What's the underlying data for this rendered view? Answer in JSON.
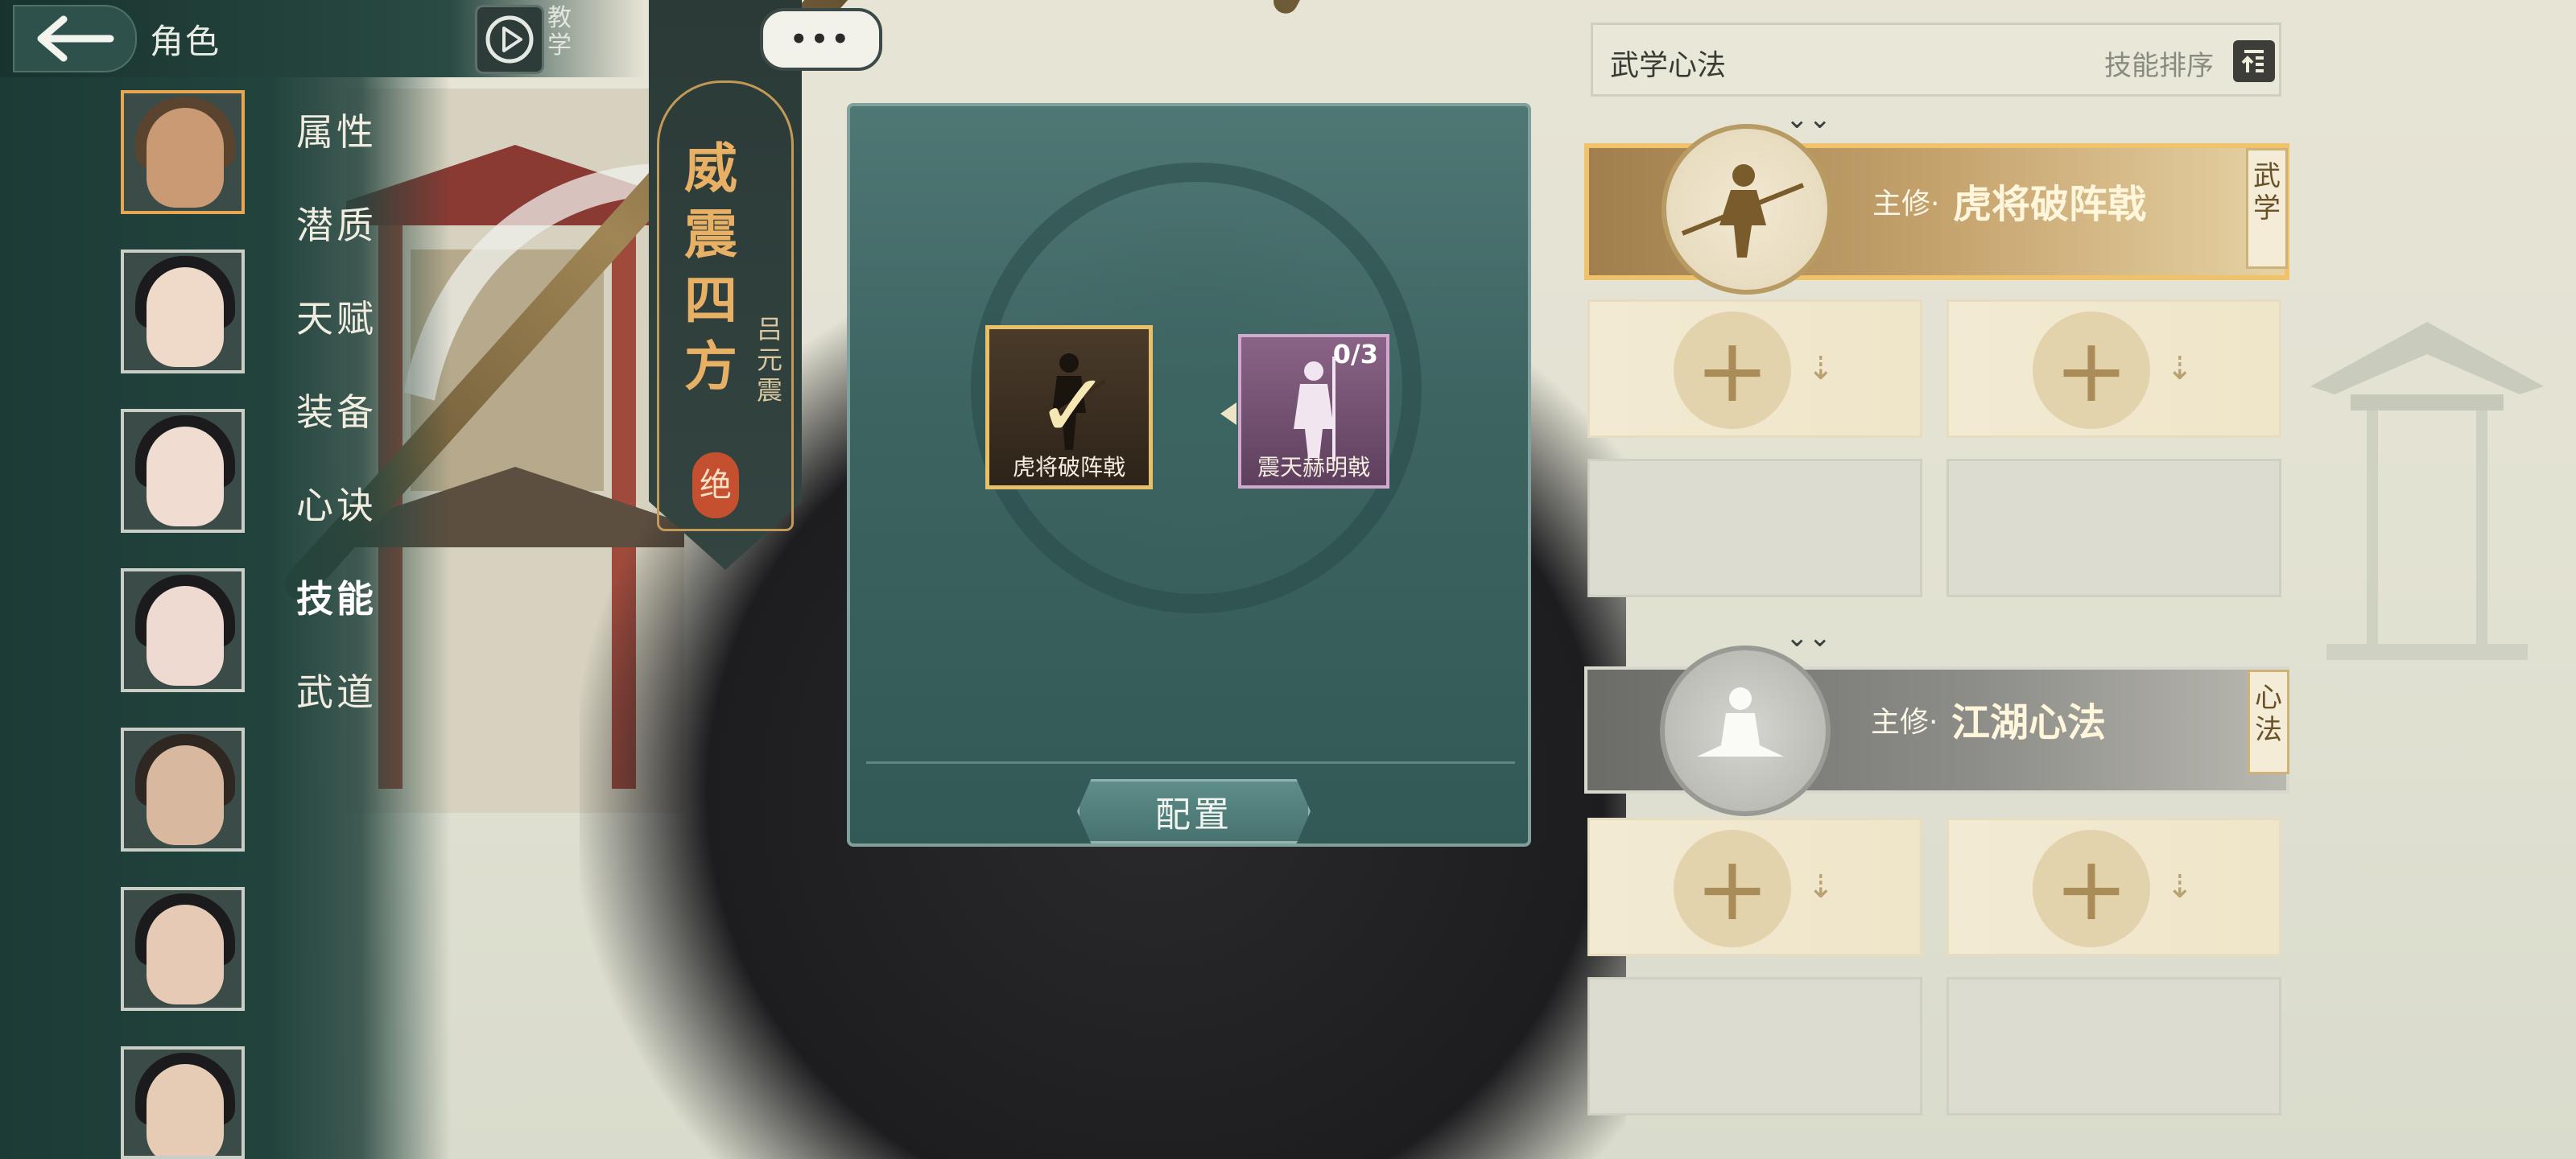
{
  "header": {
    "title": "角色",
    "tutorial_label": "教学",
    "chat_label": "•••"
  },
  "menu": [
    {
      "label": "属性",
      "active": false
    },
    {
      "label": "潜质",
      "active": false
    },
    {
      "label": "天赋",
      "active": false
    },
    {
      "label": "装备",
      "active": false
    },
    {
      "label": "心诀",
      "active": false
    },
    {
      "label": "技能",
      "active": true
    },
    {
      "label": "武道",
      "active": false
    }
  ],
  "banner": {
    "title": "威震四方",
    "name": "吕元震",
    "grade": "绝"
  },
  "modal": {
    "skills": [
      {
        "label": "虎将破阵戟",
        "state": "selected"
      },
      {
        "label": "震天赫明戟",
        "progress": "0/3",
        "state": "locked"
      }
    ],
    "config_button": "配置"
  },
  "right_panel": {
    "title": "武学心法",
    "sort_label": "技能排序",
    "martial_slot": {
      "prefix": "主修·",
      "name": "虎将破阵戟",
      "tag": "武学"
    },
    "mind_slot": {
      "prefix": "主修·",
      "name": "江湖心法",
      "tag": "心法"
    }
  },
  "colors": {
    "accent_gold": "#f0c26a",
    "panel_teal": "#3d6461",
    "sidebar": "#1d3b36"
  }
}
